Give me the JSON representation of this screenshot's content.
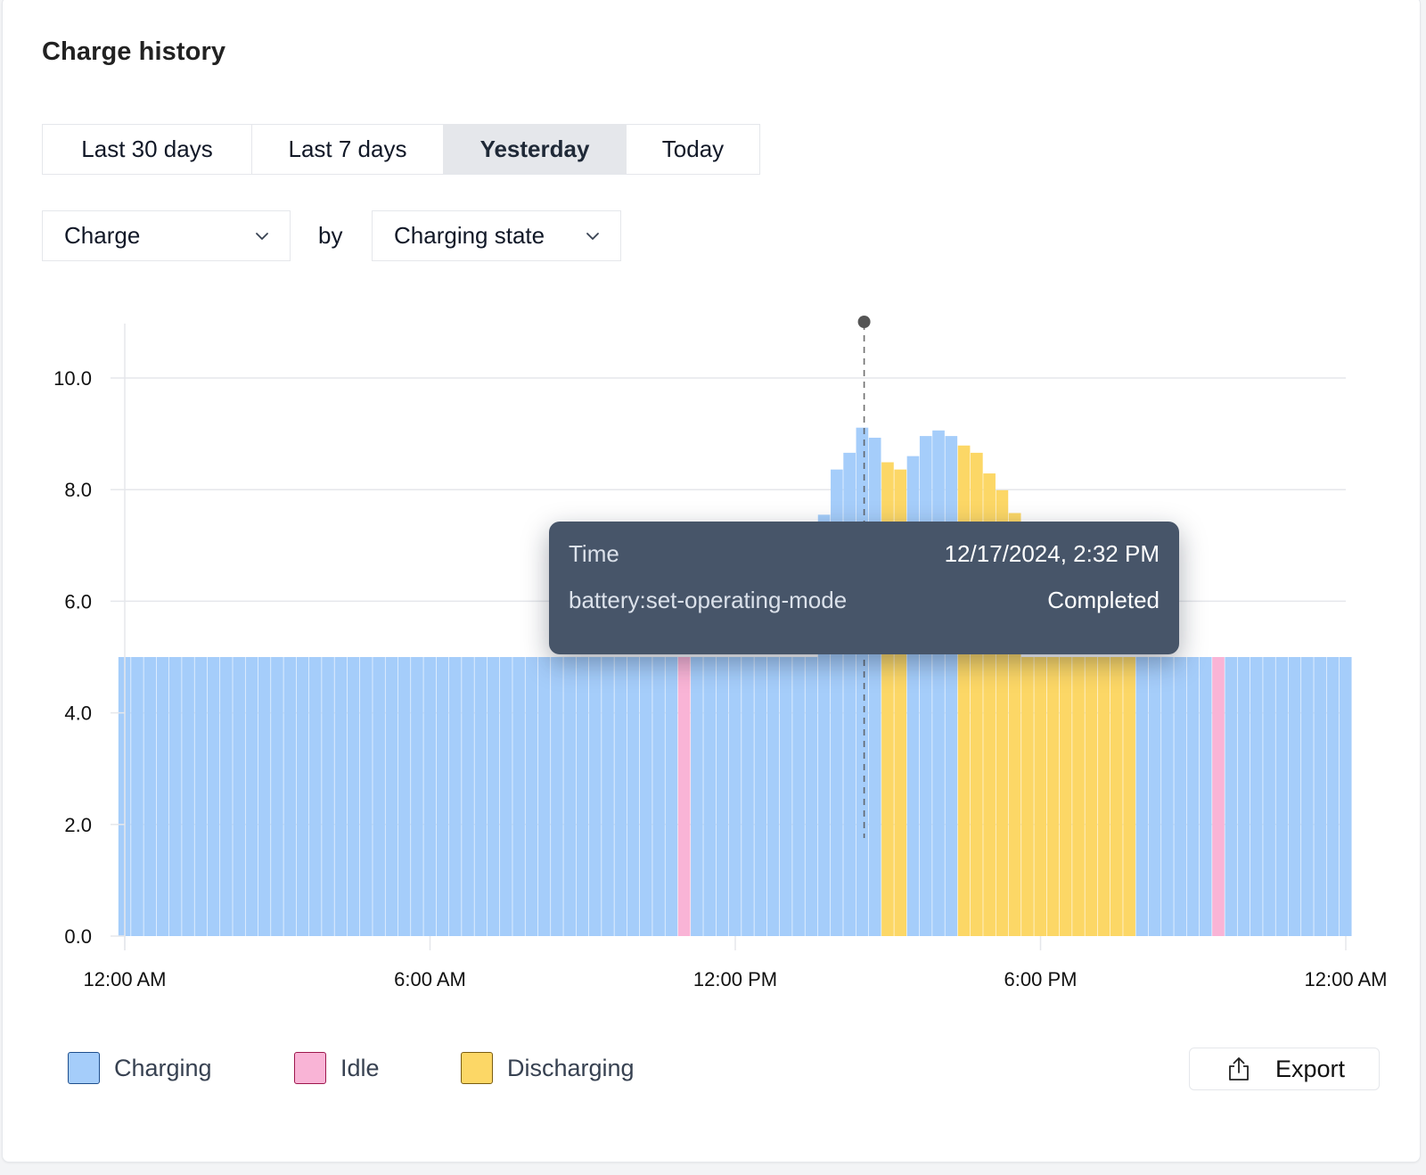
{
  "title": "Charge history",
  "range_tabs": [
    {
      "label": "Last 30 days",
      "active": false
    },
    {
      "label": "Last 7 days",
      "active": false
    },
    {
      "label": "Yesterday",
      "active": true
    },
    {
      "label": "Today",
      "active": false
    }
  ],
  "metric_select": {
    "value": "Charge",
    "icon": "chevron-down-icon"
  },
  "by_label": "by",
  "group_select": {
    "value": "Charging state",
    "icon": "chevron-down-icon"
  },
  "tooltip": {
    "rows": [
      {
        "label": "Time",
        "value": "12/17/2024, 2:32 PM"
      },
      {
        "label": "battery:set-operating-mode",
        "value": "Completed"
      }
    ]
  },
  "legend": [
    {
      "label": "Charging",
      "color": "#a5cdfa",
      "border": "#1e4e8c"
    },
    {
      "label": "Idle",
      "color": "#f9b4d6",
      "border": "#9d174d"
    },
    {
      "label": "Discharging",
      "color": "#fcd766",
      "border": "#7a5c10"
    }
  ],
  "export_button": {
    "label": "Export",
    "icon": "share-export-icon"
  },
  "colors": {
    "charging": "#a5cdfa",
    "idle": "#f9b4d6",
    "discharging": "#fcd766",
    "tooltip_bg": "#475569",
    "marker": "#555555"
  },
  "chart_data": {
    "type": "bar",
    "title": "",
    "xlabel": "",
    "ylabel": "",
    "ylim": [
      0,
      11
    ],
    "yticks": [
      0,
      2,
      4,
      6,
      8,
      10
    ],
    "ytick_labels": [
      "0.0",
      "2.0",
      "4.0",
      "6.0",
      "8.0",
      "10.0"
    ],
    "x_interval_minutes": 15,
    "xticks_hours": [
      0,
      6,
      12,
      18,
      24
    ],
    "xtick_labels": [
      "12:00 AM",
      "6:00 AM",
      "12:00 PM",
      "6:00 PM",
      "12:00 AM"
    ],
    "grid": "horizontal",
    "legend_position": "bottom-left",
    "hover_marker_hour": 14.533,
    "series_states": [
      "charging",
      "idle",
      "discharging"
    ],
    "values": [
      5.0,
      5.0,
      5.0,
      5.0,
      5.0,
      5.0,
      5.0,
      5.0,
      5.0,
      5.0,
      5.0,
      5.0,
      5.0,
      5.0,
      5.0,
      5.0,
      5.0,
      5.0,
      5.0,
      5.0,
      5.0,
      5.0,
      5.0,
      5.0,
      5.0,
      5.0,
      5.0,
      5.0,
      5.0,
      5.0,
      5.0,
      5.0,
      5.0,
      5.0,
      5.0,
      5.0,
      5.0,
      5.0,
      5.0,
      5.0,
      5.0,
      5.0,
      5.0,
      5.0,
      5.0,
      5.0,
      5.0,
      5.0,
      5.0,
      5.0,
      5.0,
      5.0,
      5.0,
      5.0,
      5.0,
      7.55,
      8.36,
      8.66,
      9.11,
      8.93,
      8.49,
      8.36,
      8.6,
      8.96,
      9.06,
      8.96,
      8.79,
      8.66,
      8.29,
      7.99,
      7.58,
      5.0,
      5.0,
      5.0,
      5.0,
      5.0,
      5.0,
      5.0,
      5.0,
      5.0,
      5.0,
      5.0,
      5.0,
      5.0,
      5.0,
      5.0,
      5.0,
      5.0,
      5.0,
      5.0,
      5.0,
      5.0,
      5.0,
      5.0,
      5.0,
      5.0,
      5.0
    ],
    "states": [
      "charging",
      "charging",
      "charging",
      "charging",
      "charging",
      "charging",
      "charging",
      "charging",
      "charging",
      "charging",
      "charging",
      "charging",
      "charging",
      "charging",
      "charging",
      "charging",
      "charging",
      "charging",
      "charging",
      "charging",
      "charging",
      "charging",
      "charging",
      "charging",
      "charging",
      "charging",
      "charging",
      "charging",
      "charging",
      "charging",
      "charging",
      "charging",
      "charging",
      "charging",
      "charging",
      "charging",
      "charging",
      "charging",
      "charging",
      "charging",
      "charging",
      "charging",
      "charging",
      "charging",
      "idle",
      "charging",
      "charging",
      "charging",
      "charging",
      "charging",
      "charging",
      "charging",
      "charging",
      "charging",
      "charging",
      "charging",
      "charging",
      "charging",
      "charging",
      "charging",
      "discharging",
      "discharging",
      "charging",
      "charging",
      "charging",
      "charging",
      "discharging",
      "discharging",
      "discharging",
      "discharging",
      "discharging",
      "discharging",
      "discharging",
      "discharging",
      "discharging",
      "discharging",
      "discharging",
      "discharging",
      "discharging",
      "discharging",
      "charging",
      "charging",
      "charging",
      "charging",
      "charging",
      "charging",
      "idle",
      "charging",
      "charging",
      "charging",
      "charging",
      "charging",
      "charging",
      "charging",
      "charging",
      "charging",
      "charging"
    ]
  }
}
